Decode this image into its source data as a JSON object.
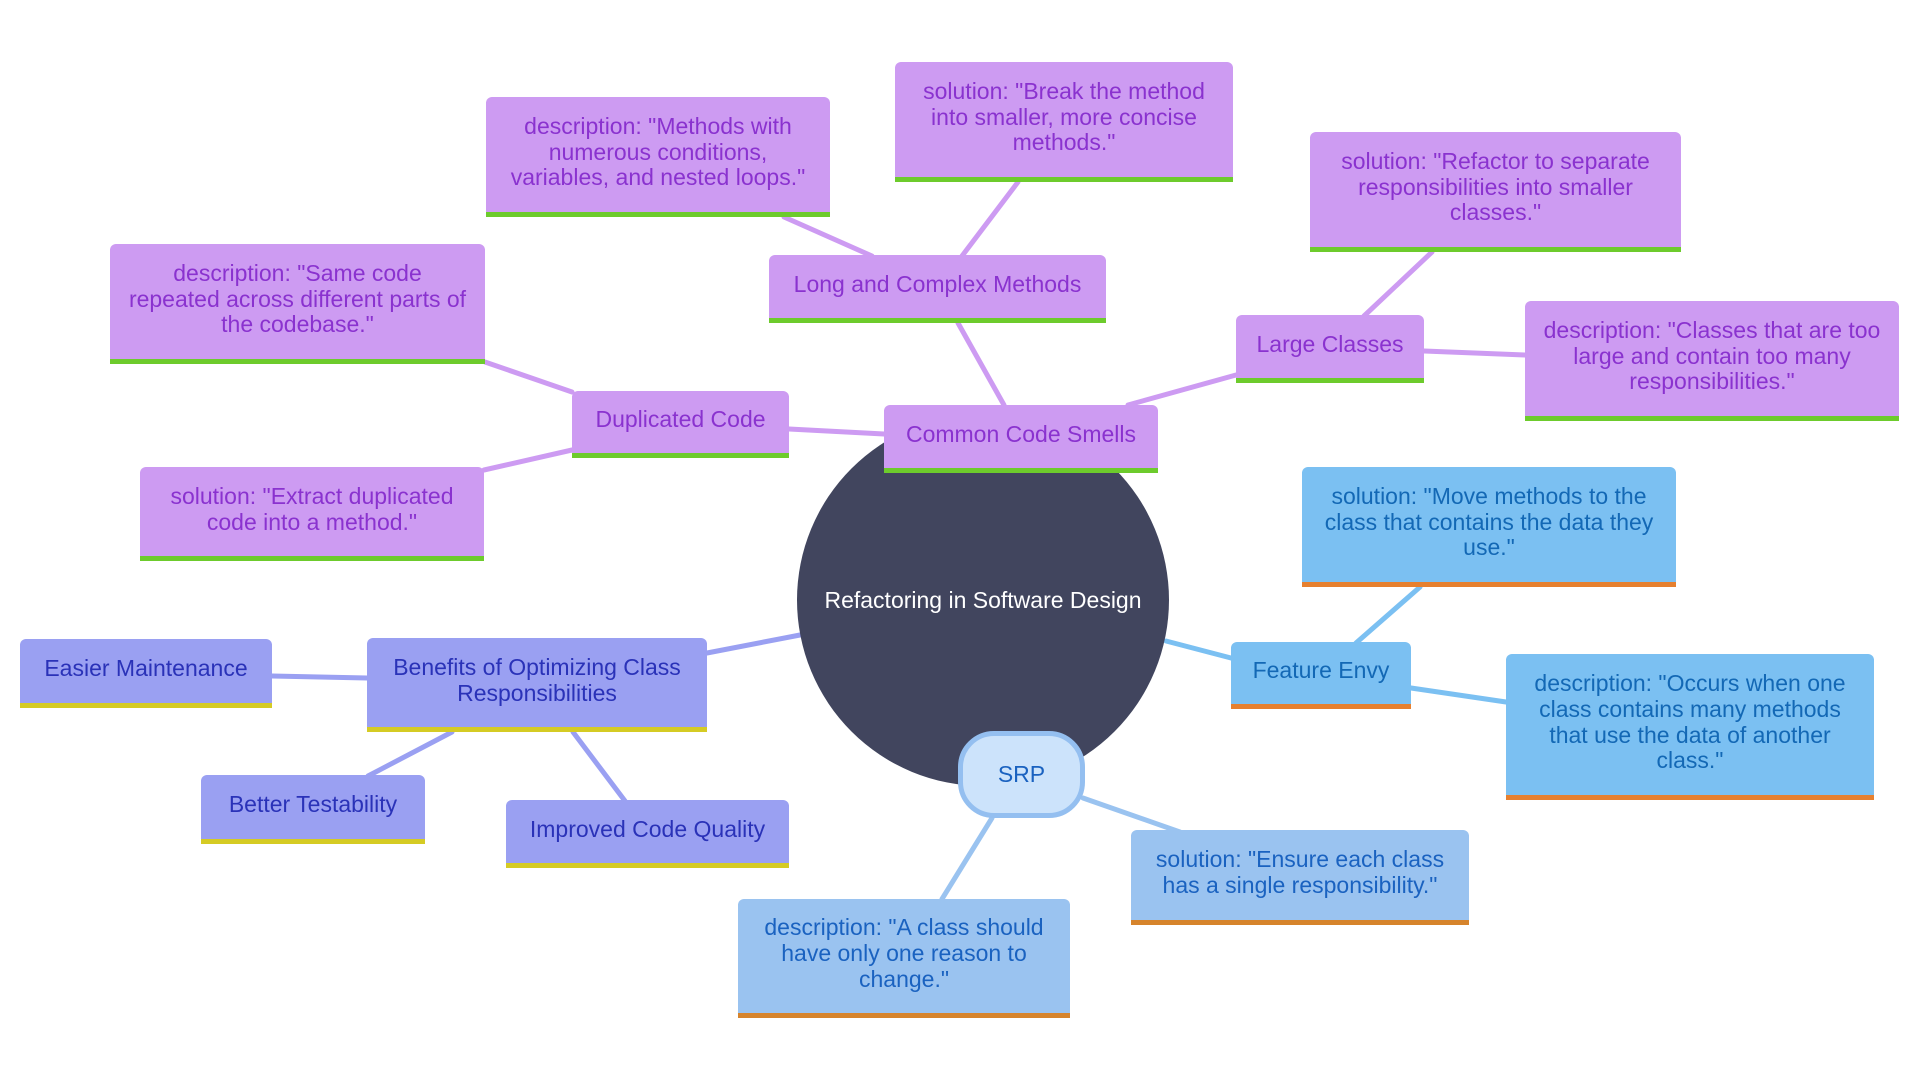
{
  "diagram": {
    "type": "mindmap",
    "root": "Refactoring in Software Design",
    "colors": {
      "root_fill": "#41455e",
      "code_smells_fill": "#cd9bf2",
      "code_smells_accent": "#6dcb2c",
      "feature_envy_fill": "#7bc0f2",
      "feature_envy_accent": "#e6802f",
      "srp_fill": "#9ac3f0",
      "srp_accent": "#d6842c",
      "benefits_fill": "#9aa0f2",
      "benefits_accent": "#d5cb24"
    },
    "nodes": {
      "common_code_smells": "Common Code Smells",
      "duplicated_code": "Duplicated Code",
      "duplicated_desc": "description: \"Same code repeated across different parts of the codebase.\"",
      "duplicated_sol": "solution: \"Extract duplicated code into a method.\"",
      "long_methods": "Long and Complex Methods",
      "long_desc": "description: \"Methods with numerous conditions, variables, and nested loops.\"",
      "long_sol": "solution: \"Break the method into smaller, more concise methods.\"",
      "large_classes": "Large Classes",
      "large_sol": "solution: \"Refactor to separate responsibilities into smaller classes.\"",
      "large_desc": "description: \"Classes that are too large and contain too many responsibilities.\"",
      "feature_envy": "Feature Envy",
      "feature_sol": "solution: \"Move methods to the class that contains the data they use.\"",
      "feature_desc": "description: \"Occurs when one class contains many methods that use the data of another class.\"",
      "srp": "SRP",
      "srp_sol": "solution: \"Ensure each class has a single responsibility.\"",
      "srp_desc": "description: \"A class should have only one reason to change.\"",
      "benefits": "Benefits of Optimizing Class Responsibilities",
      "easier_maintenance": "Easier Maintenance",
      "better_testability": "Better Testability",
      "improved_quality": "Improved Code Quality"
    }
  }
}
